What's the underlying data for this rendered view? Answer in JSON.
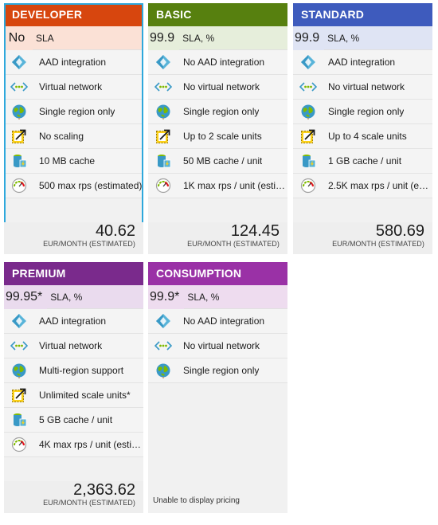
{
  "tiers": [
    {
      "name": "DEVELOPER",
      "header_color": "#d7460e",
      "sla_bg": "#fbe1d6",
      "sla_value": "No",
      "sla_label": "SLA",
      "selected": true,
      "features": [
        {
          "icon": "aad-icon",
          "text": "AAD integration"
        },
        {
          "icon": "vnet-icon",
          "text": "Virtual network"
        },
        {
          "icon": "globe-icon",
          "text": "Single region only"
        },
        {
          "icon": "scale-icon",
          "text": "No scaling"
        },
        {
          "icon": "cache-icon",
          "text": "10 MB cache"
        },
        {
          "icon": "gauge-icon",
          "text": "500 max rps (estimated)"
        }
      ],
      "price": "40.62",
      "price_unit": "EUR/MONTH (ESTIMATED)"
    },
    {
      "name": "BASIC",
      "header_color": "#57800f",
      "sla_bg": "#e6eedb",
      "sla_value": "99.9",
      "sla_label": "SLA, %",
      "selected": false,
      "features": [
        {
          "icon": "aad-icon",
          "text": "No AAD integration"
        },
        {
          "icon": "vnet-icon",
          "text": "No virtual network"
        },
        {
          "icon": "globe-icon",
          "text": "Single region only"
        },
        {
          "icon": "scale-icon",
          "text": "Up to 2 scale units"
        },
        {
          "icon": "cache-icon",
          "text": "50 MB cache / unit"
        },
        {
          "icon": "gauge-icon",
          "text": "1K max rps / unit (estimated)"
        }
      ],
      "price": "124.45",
      "price_unit": "EUR/MONTH (ESTIMATED)"
    },
    {
      "name": "STANDARD",
      "header_color": "#3e5bbd",
      "sla_bg": "#dfe4f4",
      "sla_value": "99.9",
      "sla_label": "SLA, %",
      "selected": false,
      "features": [
        {
          "icon": "aad-icon",
          "text": "AAD integration"
        },
        {
          "icon": "vnet-icon",
          "text": "No virtual network"
        },
        {
          "icon": "globe-icon",
          "text": "Single region only"
        },
        {
          "icon": "scale-icon",
          "text": "Up to 4 scale units"
        },
        {
          "icon": "cache-icon",
          "text": "1 GB cache / unit"
        },
        {
          "icon": "gauge-icon",
          "text": "2.5K max rps / unit (estimated)"
        }
      ],
      "price": "580.69",
      "price_unit": "EUR/MONTH (ESTIMATED)"
    },
    {
      "name": "PREMIUM",
      "header_color": "#7a2a8c",
      "sla_bg": "#eadbee",
      "sla_value": "99.95*",
      "sla_label": "SLA, %",
      "selected": false,
      "features": [
        {
          "icon": "aad-icon",
          "text": "AAD integration"
        },
        {
          "icon": "vnet-icon",
          "text": "Virtual network"
        },
        {
          "icon": "globe-icon",
          "text": "Multi-region support"
        },
        {
          "icon": "scale-icon",
          "text": "Unlimited scale units*"
        },
        {
          "icon": "cache-icon",
          "text": "5 GB cache / unit"
        },
        {
          "icon": "gauge-icon",
          "text": "4K max rps / unit (estimated)"
        }
      ],
      "price": "2,363.62",
      "price_unit": "EUR/MONTH (ESTIMATED)"
    },
    {
      "name": "CONSUMPTION",
      "header_color": "#9a31a6",
      "sla_bg": "#eedcef",
      "sla_value": "99.9*",
      "sla_label": "SLA, %",
      "selected": false,
      "features": [
        {
          "icon": "aad-icon",
          "text": "No AAD integration"
        },
        {
          "icon": "vnet-icon",
          "text": "No virtual network"
        },
        {
          "icon": "globe-icon",
          "text": "Single region only"
        }
      ],
      "price": "",
      "price_unit": "",
      "no_price_text": "Unable to display pricing"
    }
  ]
}
